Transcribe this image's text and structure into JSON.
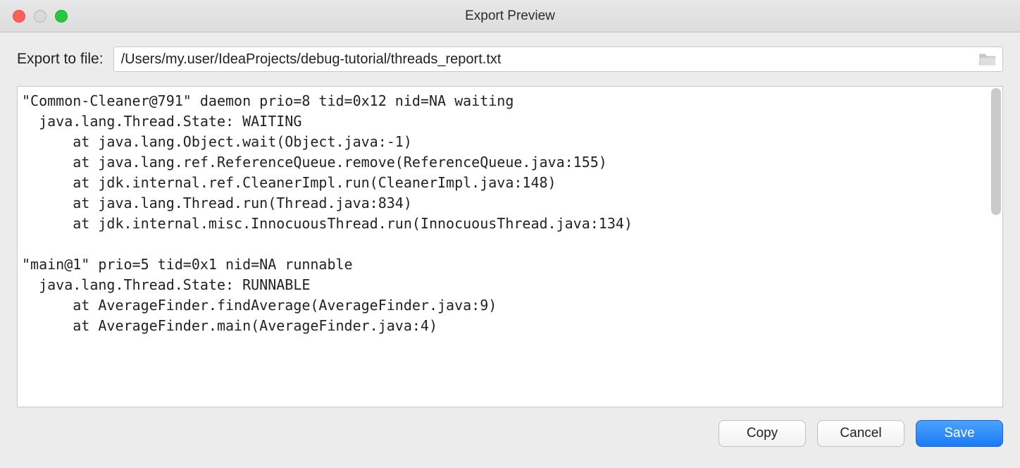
{
  "window": {
    "title": "Export Preview"
  },
  "form": {
    "file_label": "Export to file:",
    "file_path": "/Users/my.user/IdeaProjects/debug-tutorial/threads_report.txt"
  },
  "preview": {
    "text": "\"Common-Cleaner@791\" daemon prio=8 tid=0x12 nid=NA waiting\n  java.lang.Thread.State: WAITING\n      at java.lang.Object.wait(Object.java:-1)\n      at java.lang.ref.ReferenceQueue.remove(ReferenceQueue.java:155)\n      at jdk.internal.ref.CleanerImpl.run(CleanerImpl.java:148)\n      at java.lang.Thread.run(Thread.java:834)\n      at jdk.internal.misc.InnocuousThread.run(InnocuousThread.java:134)\n\n\"main@1\" prio=5 tid=0x1 nid=NA runnable\n  java.lang.Thread.State: RUNNABLE\n      at AverageFinder.findAverage(AverageFinder.java:9)\n      at AverageFinder.main(AverageFinder.java:4)"
  },
  "buttons": {
    "copy": "Copy",
    "cancel": "Cancel",
    "save": "Save"
  }
}
